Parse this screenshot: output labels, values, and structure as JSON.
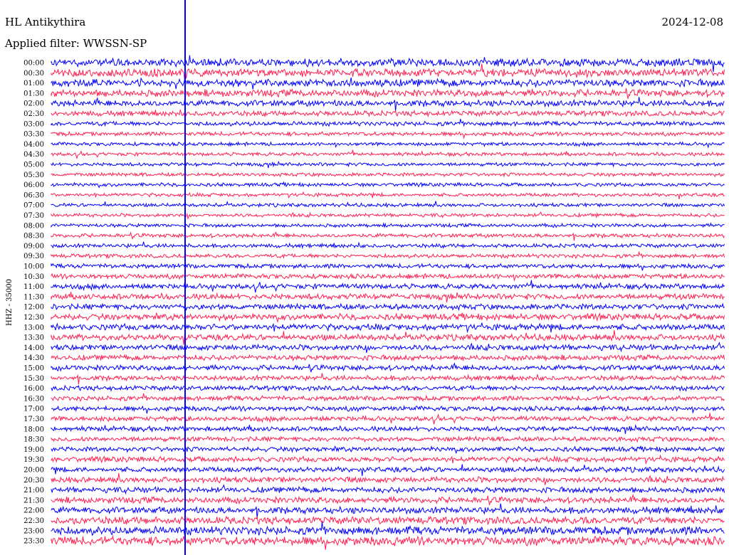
{
  "header": {
    "station": "HL Antikythira",
    "date": "2024-12-08",
    "filter": "Applied filter: WWSSN-SP"
  },
  "chart_data": {
    "type": "line",
    "title": "HL Antikythira",
    "ylabel": "HHZ - 35000",
    "trace_colors": [
      "#0000ff",
      "#ff2050"
    ],
    "row_labels": [
      "00:00",
      "00:30",
      "01:00",
      "01:30",
      "02:00",
      "02:30",
      "03:00",
      "03:30",
      "04:00",
      "04:30",
      "05:00",
      "05:30",
      "06:00",
      "06:30",
      "07:00",
      "07:30",
      "08:00",
      "08:30",
      "09:00",
      "09:30",
      "10:00",
      "10:30",
      "11:00",
      "11:30",
      "12:00",
      "12:30",
      "13:00",
      "13:30",
      "14:00",
      "14:30",
      "15:00",
      "15:30",
      "16:00",
      "16:30",
      "17:00",
      "17:30",
      "18:00",
      "18:30",
      "19:00",
      "19:30",
      "20:00",
      "20:30",
      "21:00",
      "21:30",
      "22:00",
      "22:30",
      "23:00",
      "23:30"
    ],
    "row_noise": [
      0.9,
      0.9,
      0.85,
      0.8,
      0.7,
      0.6,
      0.5,
      0.45,
      0.4,
      0.4,
      0.4,
      0.4,
      0.4,
      0.4,
      0.4,
      0.4,
      0.4,
      0.45,
      0.45,
      0.45,
      0.5,
      0.55,
      0.6,
      0.65,
      0.65,
      0.7,
      0.7,
      0.7,
      0.65,
      0.6,
      0.6,
      0.55,
      0.55,
      0.55,
      0.55,
      0.55,
      0.55,
      0.55,
      0.55,
      0.6,
      0.6,
      0.65,
      0.65,
      0.7,
      0.75,
      0.85,
      0.95,
      1.0
    ]
  }
}
